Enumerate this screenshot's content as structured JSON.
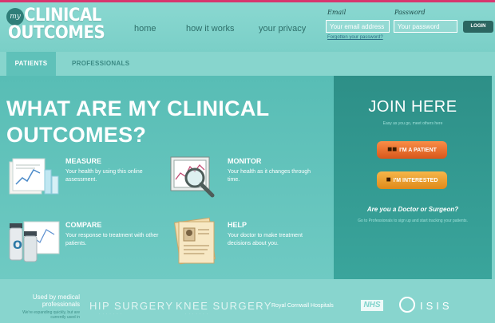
{
  "brand": {
    "badge": "my",
    "line1": "CLINICAL",
    "line2": "OUTCOMES"
  },
  "nav": {
    "home": "home",
    "how": "how it works",
    "privacy": "your privacy"
  },
  "login": {
    "email_label": "Email",
    "password_label": "Password",
    "email_placeholder": "Your email address",
    "password_placeholder": "Your password",
    "forgot": "Forgotten your password?",
    "button": "LOGIN"
  },
  "tabs": {
    "patients": "PATIENTS",
    "professionals": "PROFESSIONALS"
  },
  "main": {
    "heading": "WHAT ARE MY CLINICAL OUTCOMES?",
    "features": [
      {
        "title": "MEASURE",
        "desc": "Your health by using this online assessment.",
        "icon": "chart-documents-icon"
      },
      {
        "title": "MONITOR",
        "desc": "Your health as it changes through time.",
        "icon": "magnifier-graph-icon"
      },
      {
        "title": "COMPARE",
        "desc": "Your response to treatment with other patients.",
        "icon": "medicine-bottles-icon"
      },
      {
        "title": "HELP",
        "desc": "Your doctor to make treatment decisions about you.",
        "icon": "patient-folder-icon"
      }
    ]
  },
  "join": {
    "title": "JOIN HERE",
    "subtitle": "Easy as you go, meet others here",
    "patient_button": "I'M A PATIENT",
    "interested_button": "I'M INTERESTED",
    "doctor_question": "Are you a Doctor or Surgeon?",
    "doctor_sub": "Go to Professionals to sign up and start tracking your patients."
  },
  "footer": {
    "used_by": "Used by medical professionals",
    "note": "We're expanding quickly, but are currently used in",
    "partners": {
      "hip": "HIP SURGERY",
      "knee": "KNEE SURGERY",
      "royal": "Royal Cornwall Hospitals",
      "nhs": "NHS",
      "isis": "ISIS"
    }
  },
  "colors": {
    "accent_pink": "#d8366f",
    "teal_dark": "#2d8f87",
    "orange": "#e66a28",
    "amber": "#f0a33a"
  }
}
